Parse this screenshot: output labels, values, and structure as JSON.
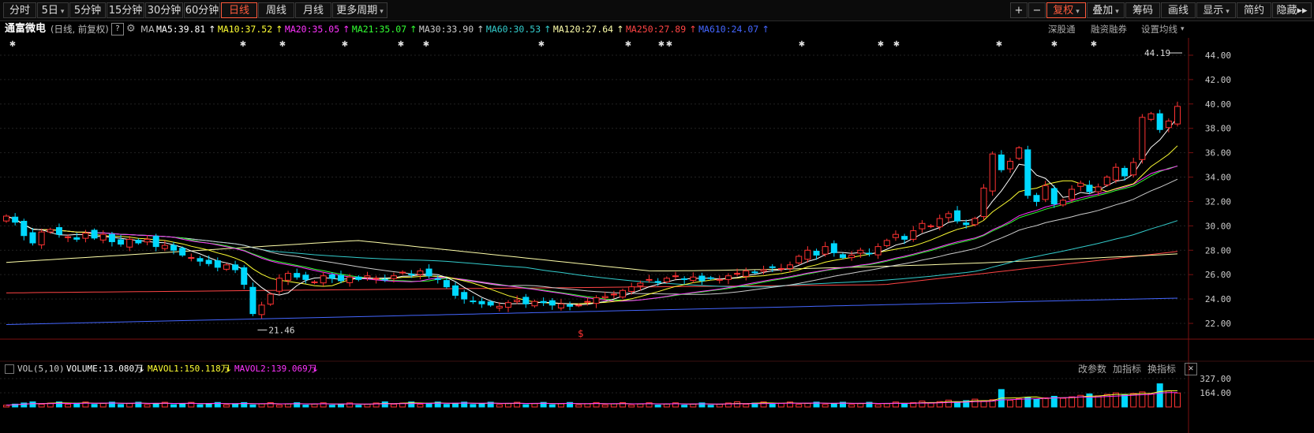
{
  "toolbar": {
    "left": [
      {
        "label": "分时",
        "w": 42
      },
      {
        "label": "5日",
        "w": 40,
        "dropdown": true
      },
      {
        "label": "5分钟",
        "w": 46
      },
      {
        "label": "15分钟",
        "w": 48
      },
      {
        "label": "30分钟",
        "w": 48
      },
      {
        "label": "60分钟",
        "w": 46
      },
      {
        "label": "日线",
        "w": 46,
        "active": true
      },
      {
        "label": "周线",
        "w": 46
      },
      {
        "label": "月线",
        "w": 46
      },
      {
        "label": "更多周期",
        "w": 70,
        "dropdown": true
      }
    ],
    "right": [
      {
        "label": "+",
        "w": 22
      },
      {
        "label": "−",
        "w": 22
      },
      {
        "label": "复权",
        "w": 50,
        "dropdown": true,
        "active": true
      },
      {
        "label": "叠加",
        "w": 48,
        "dropdown": true
      },
      {
        "label": "筹码",
        "w": 44
      },
      {
        "label": "画线",
        "w": 44
      },
      {
        "label": "显示",
        "w": 50,
        "dropdown": true
      },
      {
        "label": "简约",
        "w": 44
      },
      {
        "label": "隐藏▸▸",
        "w": 50
      }
    ]
  },
  "stock": {
    "name": "通富微电",
    "mode": "(日线, 前复权)",
    "help": "?",
    "ma_label": "MA"
  },
  "ma_legend": [
    {
      "text": "MA5:39.81",
      "color": "#ffffff",
      "arrow": "↑"
    },
    {
      "text": "MA10:37.52",
      "color": "#ffff33",
      "arrow": "↑"
    },
    {
      "text": "MA20:35.05",
      "color": "#ff33ff",
      "arrow": "↑"
    },
    {
      "text": "MA21:35.07",
      "color": "#33ff33",
      "arrow": "↑"
    },
    {
      "text": "MA30:33.90",
      "color": "#cccccc",
      "arrow": "↑"
    },
    {
      "text": "MA60:30.53",
      "color": "#33cccc",
      "arrow": "↑"
    },
    {
      "text": "MA120:27.64",
      "color": "#ffffaa",
      "arrow": "↑"
    },
    {
      "text": "MA250:27.89",
      "color": "#ff4444",
      "arrow": "↑"
    },
    {
      "text": "MA610:24.07",
      "color": "#4466ff",
      "arrow": "↑"
    }
  ],
  "right_links": [
    "深股通",
    "融资融券",
    "设置均线"
  ],
  "price_axis": [
    "44.00",
    "42.00",
    "40.00",
    "38.00",
    "36.00",
    "34.00",
    "32.00",
    "30.00",
    "28.00",
    "26.00",
    "24.00",
    "22.00"
  ],
  "annotations": {
    "high": "44.19",
    "low": "21.46",
    "marker": "$"
  },
  "vol_header": {
    "title": "VOL(5,10)",
    "volume": "VOLUME:13.080万",
    "mavol1": "MAVOL1:150.118万",
    "mavol2": "MAVOL2:139.069万",
    "links": [
      "改参数",
      "加指标",
      "换指标"
    ],
    "close": "✕"
  },
  "vol_axis": [
    "327.00",
    "164.00"
  ],
  "colors": {
    "up": "#ff3232",
    "down": "#00d8ff",
    "bg": "#000000"
  },
  "chart_data": {
    "type": "candlestick",
    "ylim": [
      21,
      45
    ],
    "closes": [
      30.8,
      30.3,
      29.2,
      28.6,
      29.5,
      29.7,
      29.3,
      29.1,
      28.9,
      29.4,
      29.0,
      29.3,
      28.7,
      28.5,
      28.9,
      28.6,
      28.9,
      28.3,
      28.4,
      28.0,
      27.6,
      27.4,
      27.1,
      26.9,
      26.6,
      26.8,
      26.4,
      25.2,
      22.8,
      23.5,
      24.4,
      25.7,
      26.1,
      25.8,
      25.6,
      25.4,
      25.9,
      25.7,
      25.5,
      25.8,
      25.6,
      25.9,
      25.7,
      25.6,
      25.9,
      26.2,
      26.0,
      26.3,
      25.9,
      25.6,
      25.0,
      24.3,
      24.0,
      23.8,
      23.6,
      23.5,
      23.4,
      23.7,
      23.9,
      23.6,
      23.8,
      23.7,
      23.5,
      23.6,
      23.4,
      23.5,
      23.8,
      24.1,
      24.2,
      24.4,
      24.7,
      25.0,
      25.3,
      25.6,
      25.4,
      25.7,
      25.9,
      25.6,
      25.8,
      25.5,
      25.7,
      25.6,
      25.9,
      26.1,
      26.3,
      26.2,
      26.4,
      26.6,
      26.5,
      26.8,
      27.5,
      28.0,
      27.6,
      28.3,
      27.8,
      27.4,
      27.6,
      28.0,
      27.7,
      28.3,
      28.8,
      29.3,
      28.9,
      29.6,
      30.2,
      30.0,
      30.6,
      31.0,
      30.4,
      30.1,
      30.6,
      33.1,
      35.9,
      34.6,
      35.3,
      36.4,
      32.5,
      32.0,
      33.3,
      31.8,
      32.1,
      33.0,
      33.5,
      32.8,
      33.2,
      34.0,
      34.8,
      34.1,
      35.2,
      38.9,
      39.2,
      37.9,
      38.6,
      39.8
    ]
  }
}
